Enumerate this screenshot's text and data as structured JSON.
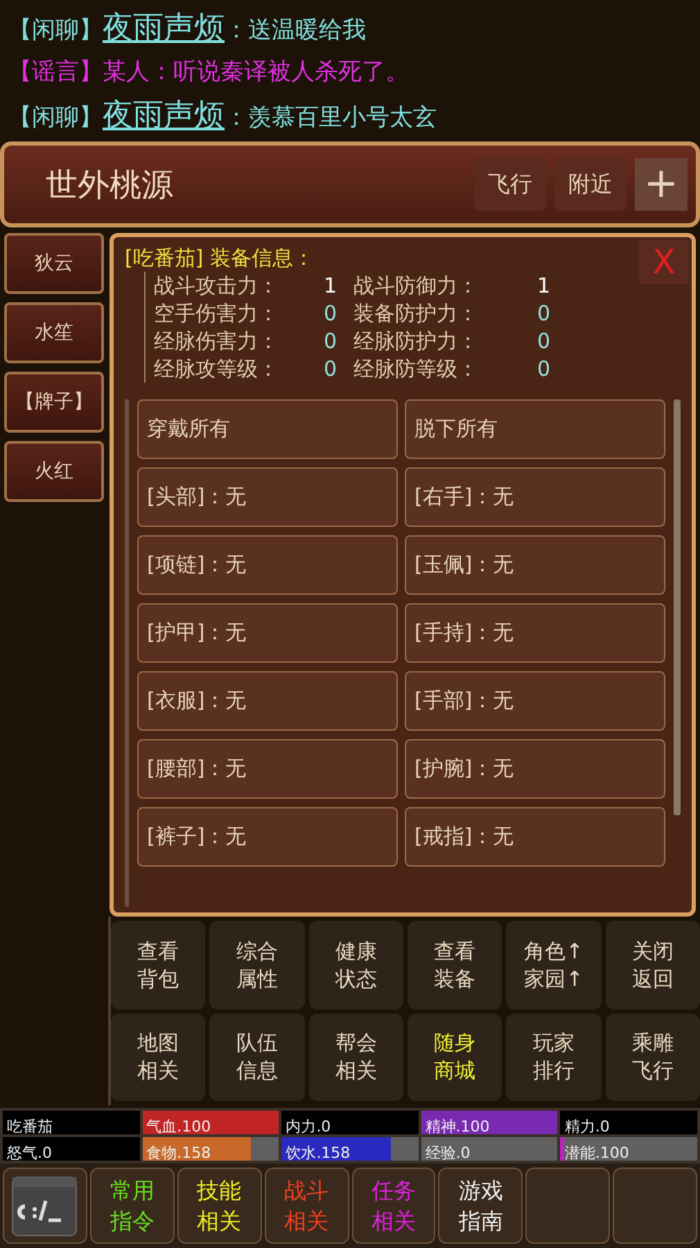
{
  "chat": [
    {
      "kind": "chat",
      "channel": "【闲聊】",
      "speaker": "夜雨声烦",
      "message": "：送温暖给我"
    },
    {
      "kind": "rumor",
      "channel": "【谣言】",
      "speaker": "某人",
      "message": "：听说秦译被人杀死了。"
    },
    {
      "kind": "chat",
      "channel": "【闲聊】",
      "speaker": "夜雨声烦",
      "message": "：羡慕百里小号太玄"
    }
  ],
  "location": {
    "title": "世外桃源",
    "buttons": [
      "飞行",
      "附近"
    ],
    "add_button": "+"
  },
  "npcs": [
    {
      "label": "狄云"
    },
    {
      "label": "水笙"
    },
    {
      "label": "【牌子】"
    },
    {
      "label": "火红"
    }
  ],
  "dialog": {
    "title": "[吃番茄] 装备信息：",
    "close": "X",
    "stats": [
      {
        "label": "战斗攻击力：",
        "value": "1",
        "color": "#ffffff"
      },
      {
        "label": "战斗防御力：",
        "value": "1",
        "color": "#ffffff"
      },
      {
        "label": "空手伤害力：",
        "value": "0",
        "color": "#8fe0e0"
      },
      {
        "label": "装备防护力：",
        "value": "0",
        "color": "#8fe0e0"
      },
      {
        "label": "经脉伤害力：",
        "value": "0",
        "color": "#8fe0e0"
      },
      {
        "label": "经脉防护力：",
        "value": "0",
        "color": "#8fe0e0"
      },
      {
        "label": "经脉攻等级：",
        "value": "0",
        "color": "#8fe0e0"
      },
      {
        "label": "经脉防等级：",
        "value": "0",
        "color": "#8fe0e0"
      }
    ],
    "slots": [
      "穿戴所有",
      "脱下所有",
      "[头部]：无",
      "[右手]：无",
      "[项链]：无",
      "[玉佩]：无",
      "[护甲]：无",
      "[手持]：无",
      "[衣服]：无",
      "[手部]：无",
      "[腰部]：无",
      "[护腕]：无",
      "[裤子]：无",
      "[戒指]：无"
    ]
  },
  "actions": [
    {
      "lines": [
        "查看",
        "背包"
      ],
      "highlight": false
    },
    {
      "lines": [
        "综合",
        "属性"
      ],
      "highlight": false
    },
    {
      "lines": [
        "健康",
        "状态"
      ],
      "highlight": false
    },
    {
      "lines": [
        "查看",
        "装备"
      ],
      "highlight": false
    },
    {
      "lines": [
        "角色↑",
        "家园↑"
      ],
      "highlight": false
    },
    {
      "lines": [
        "关闭",
        "返回"
      ],
      "highlight": false
    },
    {
      "lines": [
        "地图",
        "相关"
      ],
      "highlight": false
    },
    {
      "lines": [
        "队伍",
        "信息"
      ],
      "highlight": false
    },
    {
      "lines": [
        "帮会",
        "相关"
      ],
      "highlight": false
    },
    {
      "lines": [
        "随身",
        "商城"
      ],
      "highlight": true
    },
    {
      "lines": [
        "玩家",
        "排行"
      ],
      "highlight": false
    },
    {
      "lines": [
        "乘雕",
        "飞行"
      ],
      "highlight": false
    }
  ],
  "status": [
    {
      "kind": "plain",
      "label": "吃番茄"
    },
    {
      "kind": "bar",
      "label": "气血.100",
      "level": 1,
      "color": "#c02424"
    },
    {
      "kind": "plain",
      "label": "内力.0"
    },
    {
      "kind": "bar",
      "label": "精神.100",
      "level": 1,
      "color": "#7a2ab0"
    },
    {
      "kind": "plain",
      "label": "精力.0"
    },
    {
      "kind": "plain",
      "label": "怒气.0"
    },
    {
      "kind": "bar",
      "label": "食物.158",
      "level": 0.8,
      "color": "#c8682a"
    },
    {
      "kind": "bar",
      "label": "饮水.158",
      "level": 0.8,
      "color": "#2a2ac0"
    },
    {
      "kind": "track",
      "label": "经验.0"
    },
    {
      "kind": "bar",
      "label": "潜能.100",
      "level": 0.03,
      "color": "#c020c0"
    }
  ],
  "menu": [
    {
      "kind": "terminal"
    },
    {
      "kind": "text",
      "lines": [
        "常用",
        "指令"
      ],
      "color": "#66e020"
    },
    {
      "kind": "text",
      "lines": [
        "技能",
        "相关"
      ],
      "color": "#f0f020"
    },
    {
      "kind": "text",
      "lines": [
        "战斗",
        "相关"
      ],
      "color": "#f04020"
    },
    {
      "kind": "text",
      "lines": [
        "任务",
        "相关"
      ],
      "color": "#e020e0"
    },
    {
      "kind": "text",
      "lines": [
        "游戏",
        "指南"
      ],
      "color": "#f0f0f0"
    },
    {
      "kind": "blank"
    },
    {
      "kind": "blank"
    }
  ]
}
